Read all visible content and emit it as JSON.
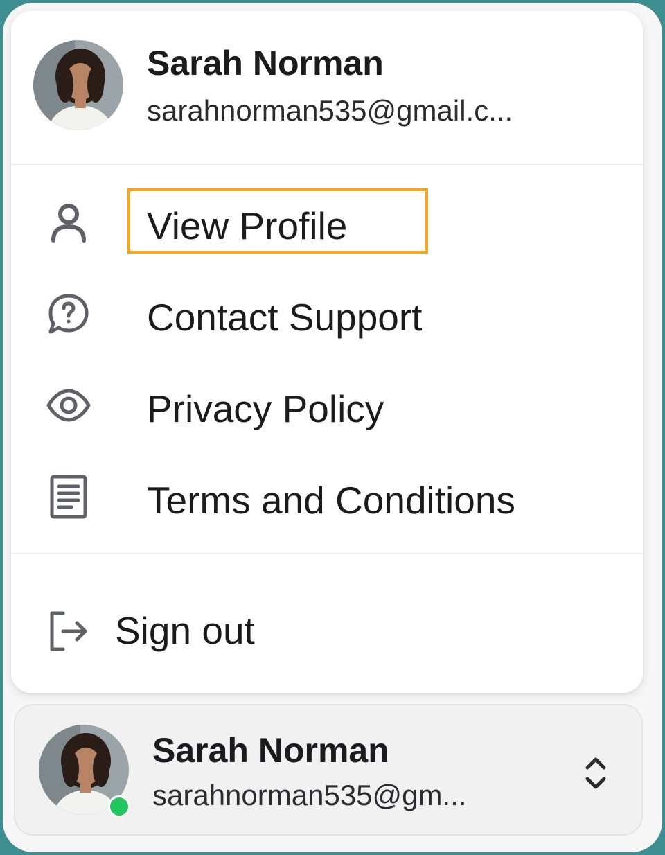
{
  "menu": {
    "user": {
      "name": "Sarah Norman",
      "email": "sarahnorman535@gmail.c..."
    },
    "items": [
      {
        "label": "View Profile",
        "icon": "user-icon"
      },
      {
        "label": "Contact Support",
        "icon": "help-chat-icon"
      },
      {
        "label": "Privacy Policy",
        "icon": "eye-icon"
      },
      {
        "label": "Terms and Conditions",
        "icon": "document-icon"
      }
    ],
    "signout": {
      "label": "Sign out",
      "icon": "sign-out-icon"
    }
  },
  "account": {
    "name": "Sarah Norman",
    "email": "sarahnorman535@gm...",
    "status": "online",
    "status_color": "#22c55e"
  },
  "colors": {
    "frame_border": "#3d8f92",
    "highlight": "#f5a623",
    "icon": "#5f6168"
  }
}
